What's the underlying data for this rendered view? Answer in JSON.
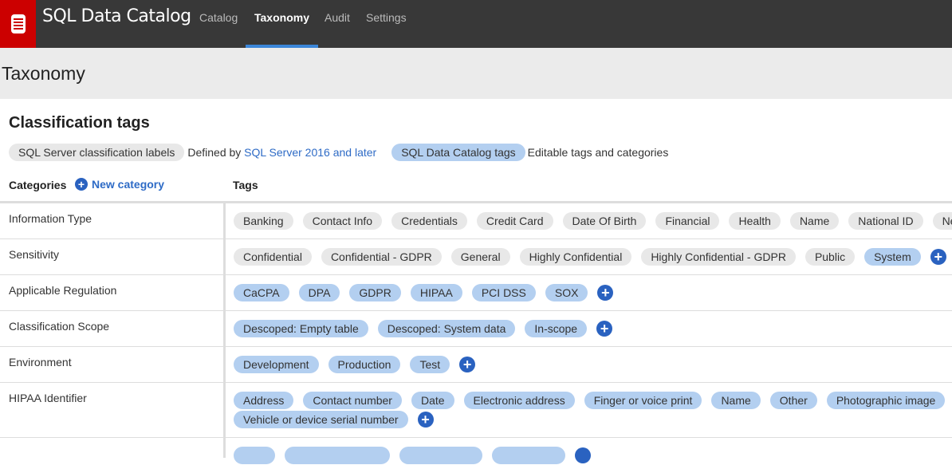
{
  "app": {
    "title": "SQL Data Catalog",
    "nav": [
      "Catalog",
      "Taxonomy",
      "Audit",
      "Settings"
    ],
    "active_nav": "Taxonomy"
  },
  "page": {
    "title": "Taxonomy",
    "section": "Classification tags"
  },
  "legend": {
    "sql_server_label": "SQL Server classification labels",
    "defined_by": "Defined by",
    "sql_server_link": "SQL Server 2016 and later",
    "catalog_label": "SQL Data Catalog tags",
    "catalog_desc": "Editable tags and categories"
  },
  "columns": {
    "categories": "Categories",
    "new_category": "New category",
    "tags": "Tags"
  },
  "colors": {
    "header": "#383838",
    "logo": "#cc0000",
    "accent": "#3b86d8",
    "pill_gray": "#e8e8e8",
    "pill_blue": "#b3cff0",
    "plus": "#2a62c0"
  },
  "rows": [
    {
      "category": "Information Type",
      "tags": [
        "Banking",
        "Contact Info",
        "Credentials",
        "Credit Card",
        "Date Of Birth",
        "Financial",
        "Health",
        "Name",
        "National ID",
        "Ne"
      ]
    },
    {
      "category": "Sensitivity",
      "tags": [
        "Confidential",
        "Confidential - GDPR",
        "General",
        "Highly Confidential",
        "Highly Confidential - GDPR",
        "Public",
        "System"
      ]
    },
    {
      "category": "Applicable Regulation",
      "tags": [
        "CaCPA",
        "DPA",
        "GDPR",
        "HIPAA",
        "PCI DSS",
        "SOX"
      ]
    },
    {
      "category": "Classification Scope",
      "tags": [
        "Descoped: Empty table",
        "Descoped: System data",
        "In-scope"
      ]
    },
    {
      "category": "Environment",
      "tags": [
        "Development",
        "Production",
        "Test"
      ]
    },
    {
      "category": "HIPAA Identifier",
      "tags": [
        "Address",
        "Contact number",
        "Date",
        "Electronic address",
        "Finger or voice print",
        "Name",
        "Other",
        "Photographic image"
      ],
      "tags2": [
        "Vehicle or device serial number"
      ]
    }
  ]
}
